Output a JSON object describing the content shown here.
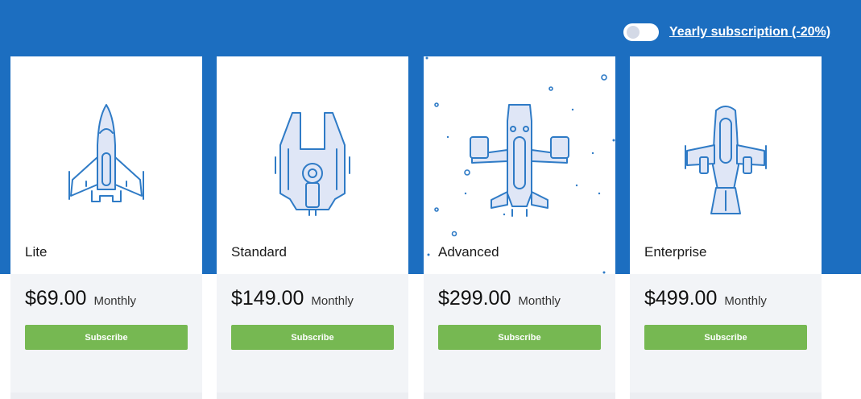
{
  "header": {
    "toggle_label": "Yearly subscription (-20%)",
    "toggle_on": false
  },
  "colors": {
    "hero_background": "#1c6ec0",
    "card_background": "#ffffff",
    "card_footer_background": "#f2f4f7",
    "subscribe_button": "#76b852",
    "illustration_stroke": "#2f7bc6"
  },
  "plans": [
    {
      "name": "Lite",
      "price": "$69.00",
      "period": "Monthly",
      "button": "Subscribe",
      "icon": "lite-spaceship-icon"
    },
    {
      "name": "Standard",
      "price": "$149.00",
      "period": "Monthly",
      "button": "Subscribe",
      "icon": "standard-spaceship-icon"
    },
    {
      "name": "Advanced",
      "price": "$299.00",
      "period": "Monthly",
      "button": "Subscribe",
      "icon": "advanced-spaceship-icon"
    },
    {
      "name": "Enterprise",
      "price": "$499.00",
      "period": "Monthly",
      "button": "Subscribe",
      "icon": "enterprise-spaceship-icon"
    }
  ]
}
